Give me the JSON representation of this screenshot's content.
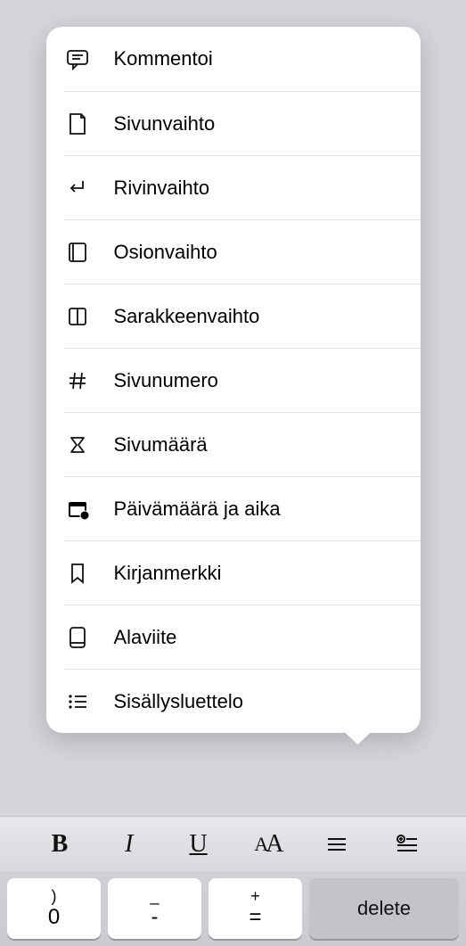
{
  "menu": {
    "items": [
      {
        "label": "Kommentoi",
        "name": "menu-item-comment",
        "icon": "comment-icon"
      },
      {
        "label": "Sivunvaihto",
        "name": "menu-item-page-break",
        "icon": "page-break-icon"
      },
      {
        "label": "Rivinvaihto",
        "name": "menu-item-line-break",
        "icon": "line-break-icon"
      },
      {
        "label": "Osionvaihto",
        "name": "menu-item-section-break",
        "icon": "section-break-icon"
      },
      {
        "label": "Sarakkeenvaihto",
        "name": "menu-item-column-break",
        "icon": "column-break-icon"
      },
      {
        "label": "Sivunumero",
        "name": "menu-item-page-number",
        "icon": "page-number-icon"
      },
      {
        "label": "Sivumäärä",
        "name": "menu-item-page-count",
        "icon": "page-count-icon"
      },
      {
        "label": "Päivämäärä ja aika",
        "name": "menu-item-date-time",
        "icon": "date-time-icon"
      },
      {
        "label": "Kirjanmerkki",
        "name": "menu-item-bookmark",
        "icon": "bookmark-icon"
      },
      {
        "label": "Alaviite",
        "name": "menu-item-footnote",
        "icon": "footnote-icon"
      },
      {
        "label": "Sisällysluettelo",
        "name": "menu-item-toc",
        "icon": "toc-icon"
      }
    ]
  },
  "toolbar": {
    "bold": "B",
    "italic": "I",
    "underline": "U",
    "font": "AA"
  },
  "keyboard": {
    "key1_top": ")",
    "key1_bot": "0",
    "key2_top": "_",
    "key2_bot": "-",
    "key3_top": "+",
    "key3_bot": "=",
    "delete": "delete"
  }
}
